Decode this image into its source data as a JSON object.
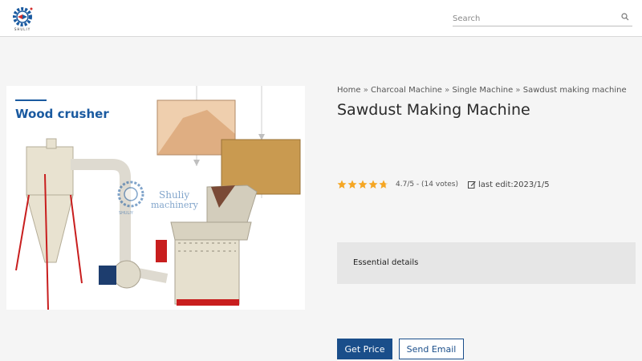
{
  "brand": {
    "logo_text": "SHULIY",
    "colors": {
      "red": "#d42d2d",
      "blue": "#1a5aa0"
    }
  },
  "search": {
    "placeholder": "Search"
  },
  "breadcrumb": {
    "items": [
      "Home",
      "Charcoal Machine",
      "Single Machine",
      "Sawdust making machine"
    ],
    "separator": "»"
  },
  "product": {
    "title": "Sawdust Making Machine",
    "image": {
      "heading": "Wood crusher",
      "watermark_line1": "Shuliy",
      "watermark_line2": "machinery",
      "watermark_brand": "SHULIY"
    },
    "rating": {
      "stars": 4.7,
      "max": 5,
      "text": "4.7/5 - (14 votes)"
    },
    "last_edit": "last edit:2023/1/5",
    "details_label": "Essential details"
  },
  "buttons": {
    "get_price": "Get Price",
    "send_email": "Send Email"
  },
  "colors": {
    "accent": "#1a4e8a",
    "star": "#f5a623"
  }
}
